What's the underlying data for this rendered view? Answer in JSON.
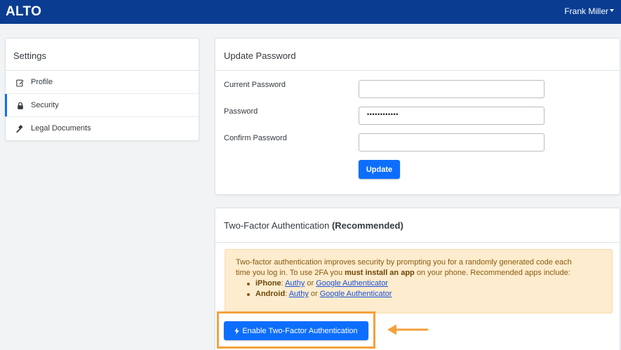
{
  "navbar": {
    "brand": "ALTO",
    "user_name": "Frank Miller"
  },
  "sidebar": {
    "title": "Settings",
    "items": [
      {
        "label": "Profile",
        "icon": "edit-icon"
      },
      {
        "label": "Security",
        "icon": "lock-icon",
        "active": true
      },
      {
        "label": "Legal Documents",
        "icon": "gavel-icon"
      }
    ]
  },
  "update_password": {
    "title": "Update Password",
    "current_label": "Current Password",
    "current_value": "",
    "password_label": "Password",
    "password_value": "••••••••••••",
    "confirm_label": "Confirm Password",
    "confirm_value": "",
    "update_button": "Update"
  },
  "two_factor": {
    "title": "Two-Factor Authentication",
    "title_suffix": "(Recommended)",
    "info_line1": "Two-factor authentication improves security by prompting you for a randomly generated code each",
    "info_line2_pre": "time you log in. To use 2FA you ",
    "info_line2_bold": "must install an app",
    "info_line2_post": " on your phone. Recommended apps include:",
    "platforms": [
      {
        "name": "iPhone",
        "app1": "Authy",
        "sep": "or",
        "app2": "Google Authenticator"
      },
      {
        "name": "Android",
        "app1": "Authy",
        "sep": "or",
        "app2": "Google Authenticator"
      }
    ],
    "enable_button": "Enable Two-Factor Authentication"
  },
  "colors": {
    "navbar": "#0a3d91",
    "primary": "#0d6efd",
    "alert_bg": "#fdeccd",
    "highlight": "#f5a13d"
  }
}
